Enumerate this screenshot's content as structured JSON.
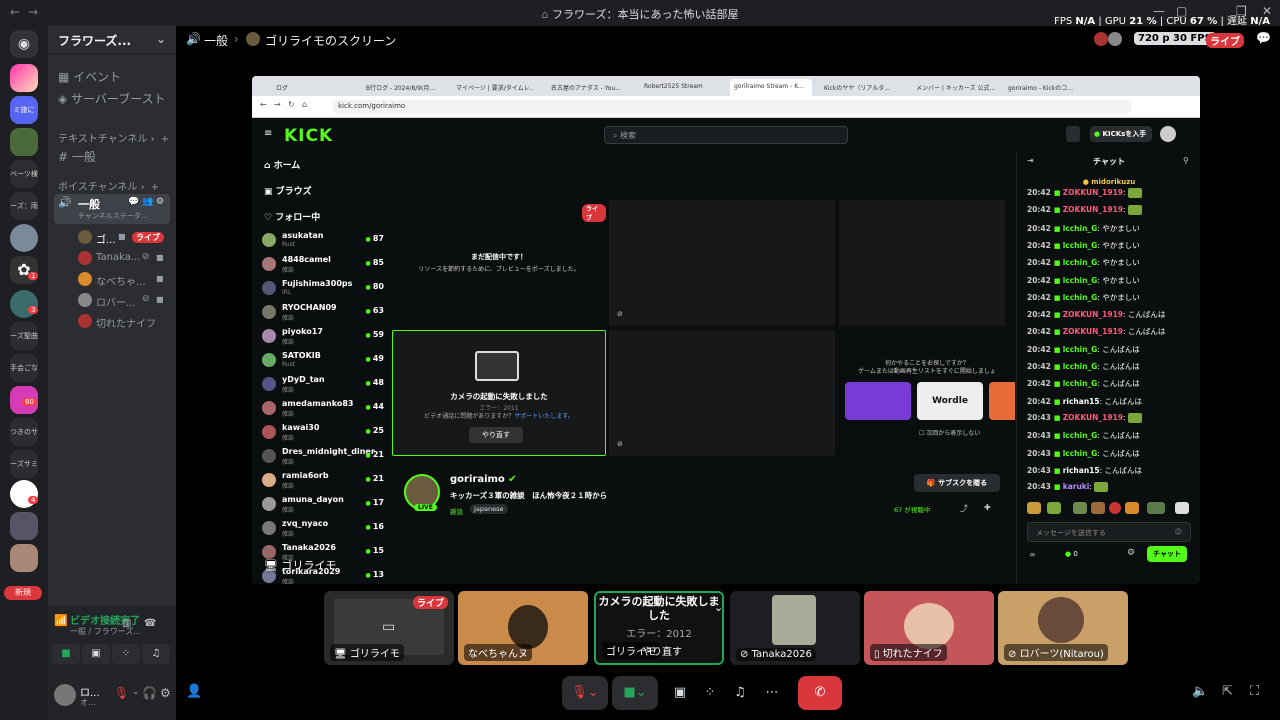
{
  "titlebar": {
    "back": "←",
    "forward": "→",
    "title": "フラワーズ：本当にあった怖い話部屋",
    "fps_label": "FPS",
    "fps_val": "N/A",
    "gpu_label": "GPU",
    "gpu_val": "21 %",
    "cpu_label": "CPU",
    "cpu_val": "67 %",
    "lat_label": "遅延",
    "lat_val": "N/A"
  },
  "server": {
    "name": "フラワーズ...",
    "events": "イベント",
    "boost": "サーバーブースト",
    "text_cat": "テキストチャンネル",
    "text_channel": "一般",
    "voice_cat": "ボイスチャンネル",
    "voice_channel": "一般",
    "voice_status": "チャンネルステータ..."
  },
  "guild_labels": [
    "ミ旅に",
    "ーズ：雨音",
    "ーズ聖曲",
    "手会ごな",
    "つきのサ",
    "ーズサミ"
  ],
  "guild_badges": [
    "1",
    "3",
    "80",
    "4"
  ],
  "new_label": "新規",
  "voice_users": [
    {
      "name": "ゴ...",
      "live": "ライブ",
      "color": "#6a5b3f"
    },
    {
      "name": "Tanaka...",
      "color": "#a33"
    },
    {
      "name": "なべちゃ...",
      "color": "#d98a2e"
    },
    {
      "name": "ロバー...",
      "color": "#888"
    },
    {
      "name": "切れたナイフ",
      "color": "#a33"
    }
  ],
  "voice_panel": {
    "status": "ビデオ接続完了",
    "sub": "一般 / フラワーズ...",
    "user": "ロ...",
    "user_sub": "オ..."
  },
  "main_header": {
    "channel": "一般",
    "screen": "ゴリライモのスクリーン",
    "quality": "720 p 30 FPS",
    "live": "ライブ"
  },
  "browser": {
    "tabs": [
      "ログ",
      "B行ログ - 2024/8/9(月...",
      "マイページ | 要求/タイムレ...",
      "名古屋のアナダス - You...",
      "Robert2525 Stream",
      "gorilraimo Stream - K...",
      "Kickのヤヤ（リアルタ...",
      "メンバー | キッカーズ 公式...",
      "goriraimo - Kickのコ..."
    ],
    "url": "kick.com/goriraimo"
  },
  "kick": {
    "logo": "KICK",
    "search": "検索",
    "kicks_btn": "KICKsを入手",
    "nav": [
      "ホーム",
      "ブラウズ",
      "フォロー中"
    ],
    "following": [
      {
        "name": "asukatan",
        "cat": "Rust",
        "viewers": "87",
        "color": "#8a6"
      },
      {
        "name": "4848camel",
        "cat": "雑談",
        "viewers": "85",
        "color": "#a77"
      },
      {
        "name": "Fujishima300ps",
        "cat": "IRL",
        "viewers": "80",
        "color": "#557"
      },
      {
        "name": "RYOCHAN09",
        "cat": "雑談",
        "viewers": "63",
        "color": "#776"
      },
      {
        "name": "piyoko17",
        "cat": "雑談",
        "viewers": "59",
        "color": "#a8a"
      },
      {
        "name": "SATOKIB",
        "cat": "Rust",
        "viewers": "49",
        "color": "#6a6"
      },
      {
        "name": "yDyD_tan",
        "cat": "雑談",
        "viewers": "48",
        "color": "#558"
      },
      {
        "name": "amedamanko83",
        "cat": "雑談",
        "viewers": "44",
        "color": "#a66"
      },
      {
        "name": "kawai30",
        "cat": "雑談",
        "viewers": "25",
        "color": "#a55"
      },
      {
        "name": "Dres_midnight_diner",
        "cat": "雑談",
        "viewers": "21",
        "color": "#555"
      },
      {
        "name": "ramia6orb",
        "cat": "雑談",
        "viewers": "21",
        "color": "#da8"
      },
      {
        "name": "amuna_dayon",
        "cat": "雑談",
        "viewers": "17",
        "color": "#999"
      },
      {
        "name": "zvq_nyaco",
        "cat": "雑談",
        "viewers": "16",
        "color": "#777"
      },
      {
        "name": "Tanaka2026",
        "cat": "雑談",
        "viewers": "15",
        "color": "#966"
      },
      {
        "name": "torikara2029",
        "cat": "雑談",
        "viewers": "13",
        "color": "#779"
      }
    ],
    "live_badge": "ライブ",
    "offline_title": "まだ配信中です！",
    "offline_sub": "リソースを節約するために、プレビューをポーズしました。",
    "cam_fail": "カメラの起動に失敗しました",
    "cam_err": "エラー：2011",
    "cam_help": "ビデオ通話に問題がありますか？",
    "cam_help_link": "サポートいたします。",
    "retry": "やり直す",
    "game_prompt": "何かやることをお探しですか？",
    "game_sub": "ゲームまたは動画再生リストをすぐに開始しましょ",
    "wordle": "Wordle",
    "dont_show": "次回から表示しない",
    "streamer": "goriraimo",
    "stream_title": "キッカーズ３軍の雑談　ほん怖今夜２１時から",
    "tags": [
      "雑談",
      "Japanese"
    ],
    "sub_btn": "サブスクを贈る",
    "watching": "67 が視聴中",
    "chat_title": "チャット",
    "pinned_user": "midorikuzu",
    "chat": [
      {
        "t": "20:42",
        "u": "ZOKKUN_1919",
        "m": "",
        "c": "#ff5a7a",
        "emote": true
      },
      {
        "t": "20:42",
        "u": "ZOKKUN_1919",
        "m": "",
        "c": "#ff5a7a",
        "emote": true
      },
      {
        "t": "20:42",
        "u": "lcchin_G",
        "m": "やかましい",
        "c": "#53fc18"
      },
      {
        "t": "20:42",
        "u": "lcchin_G",
        "m": "やかましい",
        "c": "#53fc18"
      },
      {
        "t": "20:42",
        "u": "lcchin_G",
        "m": "やかましい",
        "c": "#53fc18"
      },
      {
        "t": "20:42",
        "u": "lcchin_G",
        "m": "やかましい",
        "c": "#53fc18"
      },
      {
        "t": "20:42",
        "u": "lcchin_G",
        "m": "やかましい",
        "c": "#53fc18"
      },
      {
        "t": "20:42",
        "u": "ZOKKUN_1919",
        "m": "こんばんは",
        "c": "#ff5a7a"
      },
      {
        "t": "20:42",
        "u": "ZOKKUN_1919",
        "m": "こんばんは",
        "c": "#ff5a7a"
      },
      {
        "t": "20:42",
        "u": "lcchin_G",
        "m": "こんばんは",
        "c": "#53fc18"
      },
      {
        "t": "20:42",
        "u": "lcchin_G",
        "m": "こんばんは",
        "c": "#53fc18"
      },
      {
        "t": "20:42",
        "u": "lcchin_G",
        "m": "こんばんは",
        "c": "#53fc18"
      },
      {
        "t": "20:42",
        "u": "richan15",
        "m": "こんばんは",
        "c": "#ffffff"
      },
      {
        "t": "20:43",
        "u": "ZOKKUN_1919",
        "m": "",
        "c": "#ff5a7a",
        "emote": true
      },
      {
        "t": "20:43",
        "u": "lcchin_G",
        "m": "こんばんは",
        "c": "#53fc18"
      },
      {
        "t": "20:43",
        "u": "lcchin_G",
        "m": "こんばんは",
        "c": "#53fc18"
      },
      {
        "t": "20:43",
        "u": "richan15",
        "m": "こんばんは",
        "c": "#ffffff"
      },
      {
        "t": "20:43",
        "u": "karuki",
        "m": "",
        "c": "#b78cff",
        "emote": true
      }
    ],
    "chat_placeholder": "メッセージを送信する",
    "chat_send": "チャット",
    "points": "0"
  },
  "share_caption": "ゴリライモ",
  "tiles": [
    {
      "label": "ゴリライモ",
      "live": "ライブ",
      "bg": "#2a2a2a"
    },
    {
      "label": "なべちゃんヌ",
      "bg": "#c98a4a"
    },
    {
      "label": "ゴリライモ",
      "cam_fail": "カメラの起動に失敗しました",
      "err": "エラー：2012",
      "retry": "やり直す",
      "bg": "#111"
    },
    {
      "label": "Tanaka2026",
      "bg": "#1e1f22"
    },
    {
      "label": "切れたナイフ",
      "bg": "#c4565a"
    },
    {
      "label": "ロバーツ(Nitarou)",
      "bg": "#c8a068"
    }
  ]
}
